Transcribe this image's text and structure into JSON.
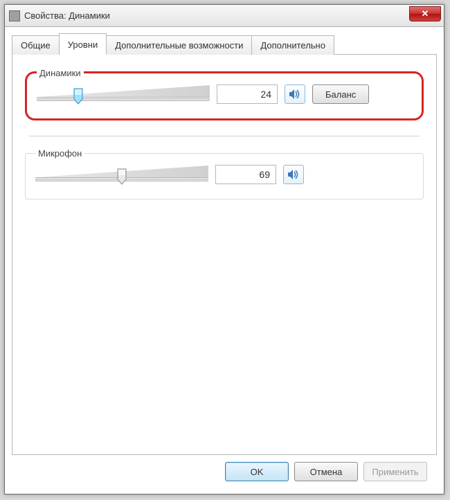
{
  "window": {
    "title": "Свойства: Динамики"
  },
  "tabs": {
    "general": "Общие",
    "levels": "Уровни",
    "enhancements": "Дополнительные возможности",
    "advanced": "Дополнительно"
  },
  "speakers": {
    "label": "Динамики",
    "value": "24",
    "slider_percent": 24,
    "balance_label": "Баланс"
  },
  "microphone": {
    "label": "Микрофон",
    "value": "69",
    "slider_percent": 50
  },
  "footer": {
    "ok": "OK",
    "cancel": "Отмена",
    "apply": "Применить"
  },
  "colors": {
    "highlight": "#d62424",
    "thumb_active": "#55c3ef",
    "thumb_inactive": "#d8d8d8"
  }
}
